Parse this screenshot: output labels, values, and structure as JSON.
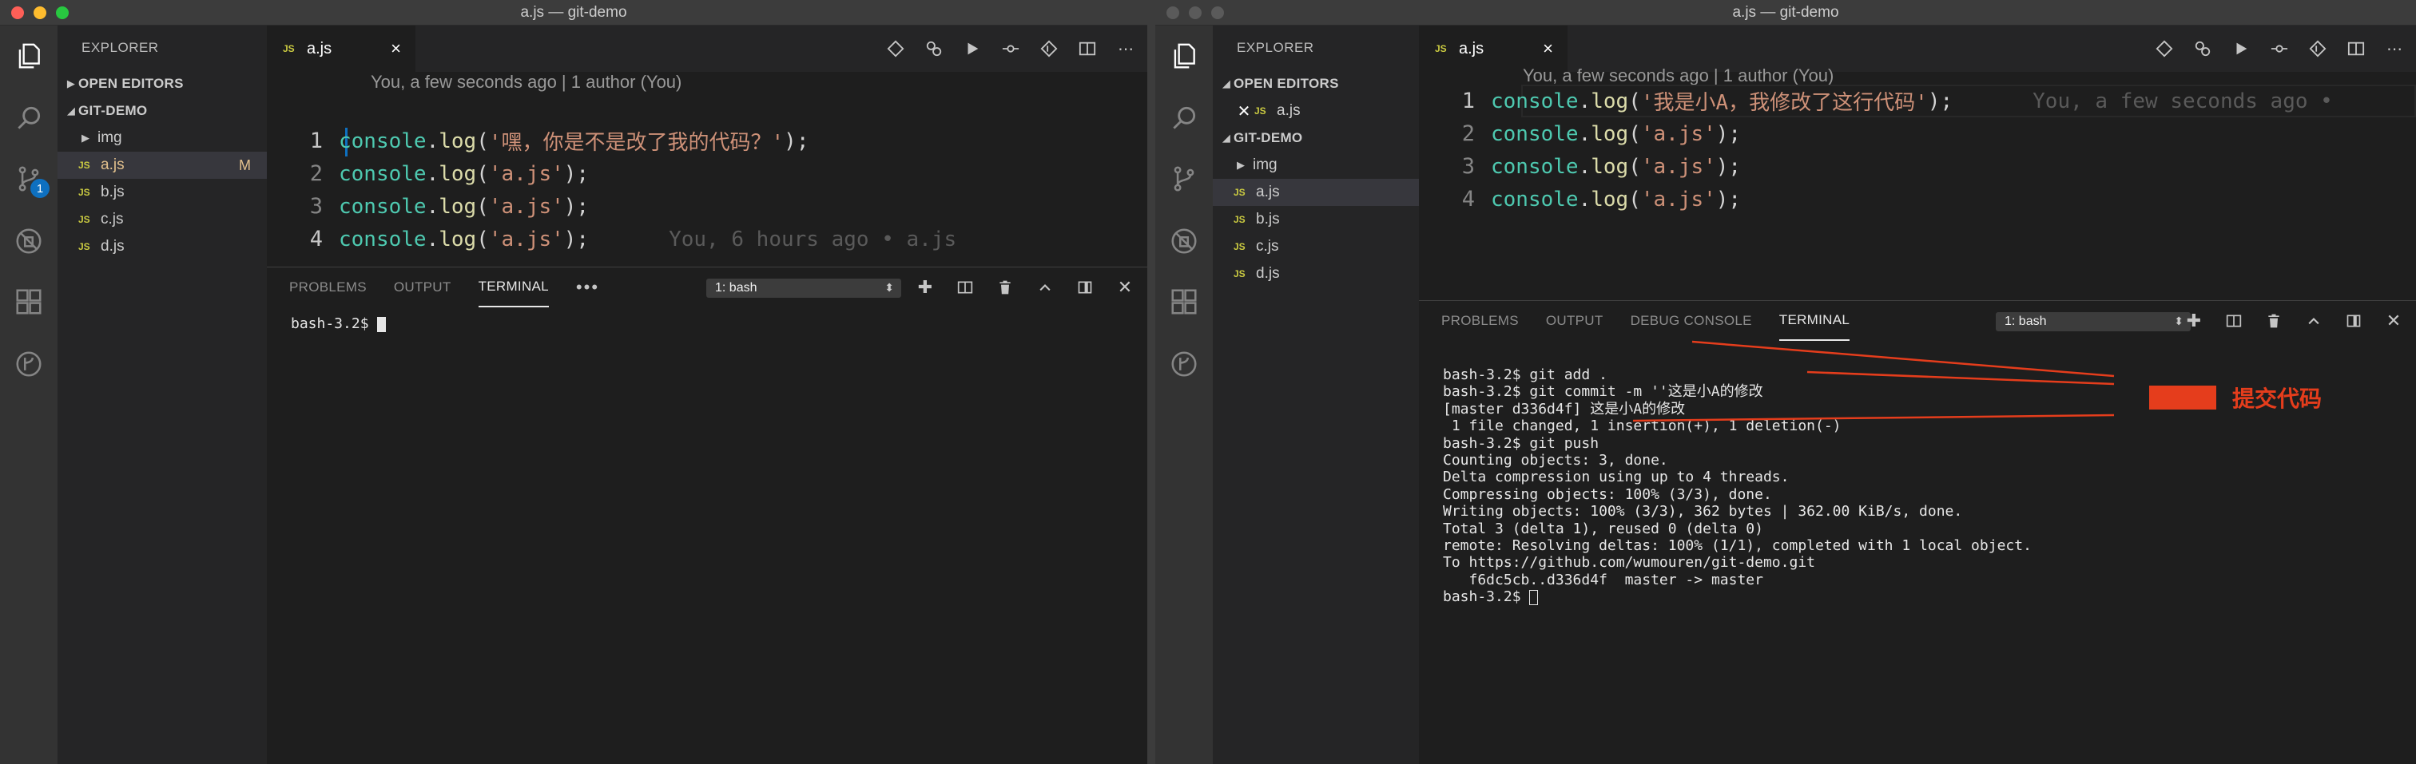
{
  "left": {
    "window_title": "a.js — git-demo",
    "explorer_title": "EXPLORER",
    "sections": {
      "open_editors": "OPEN EDITORS",
      "project": "GIT-DEMO"
    },
    "files": [
      {
        "name": "img",
        "type": "folder"
      },
      {
        "name": "a.js",
        "type": "js",
        "modified": "M"
      },
      {
        "name": "b.js",
        "type": "js"
      },
      {
        "name": "c.js",
        "type": "js"
      },
      {
        "name": "d.js",
        "type": "js"
      }
    ],
    "scm_badge": "1",
    "tab": {
      "icon": "JS",
      "label": "a.js",
      "close": "×"
    },
    "codelens": "You, a few seconds ago | 1 author (You)",
    "code": [
      {
        "num": "1",
        "obj": "console",
        "dot": ".",
        "fn": "log",
        "open": "(",
        "str": "'嘿，你是不是改了我的代码？'",
        "close": ");"
      },
      {
        "num": "2",
        "obj": "console",
        "dot": ".",
        "fn": "log",
        "open": "(",
        "str": "'a.js'",
        "close": ");"
      },
      {
        "num": "3",
        "obj": "console",
        "dot": ".",
        "fn": "log",
        "open": "(",
        "str": "'a.js'",
        "close": ");"
      },
      {
        "num": "4",
        "obj": "console",
        "dot": ".",
        "fn": "log",
        "open": "(",
        "str": "'a.js'",
        "close": ");",
        "blame": "You, 6 hours ago • a.js"
      }
    ],
    "panel_tabs": [
      "PROBLEMS",
      "OUTPUT",
      "TERMINAL"
    ],
    "panel_more": "•••",
    "terminal_select": "1: bash",
    "terminal": [
      "bash-3.2$ "
    ]
  },
  "right": {
    "window_title": "a.js — git-demo",
    "explorer_title": "EXPLORER",
    "sections": {
      "open_editors": "OPEN EDITORS",
      "project": "GIT-DEMO"
    },
    "open_editor_file": "a.js",
    "files": [
      {
        "name": "img",
        "type": "folder"
      },
      {
        "name": "a.js",
        "type": "js"
      },
      {
        "name": "b.js",
        "type": "js"
      },
      {
        "name": "c.js",
        "type": "js"
      },
      {
        "name": "d.js",
        "type": "js"
      }
    ],
    "tab": {
      "icon": "JS",
      "label": "a.js",
      "close": "×"
    },
    "codelens": "You, a few seconds ago | 1 author (You)",
    "code": [
      {
        "num": "1",
        "obj": "console",
        "dot": ".",
        "fn": "log",
        "open": "(",
        "str": "'我是小A，我修改了这行代码'",
        "close": ");",
        "blame": "You, a few seconds ago •"
      },
      {
        "num": "2",
        "obj": "console",
        "dot": ".",
        "fn": "log",
        "open": "(",
        "str": "'a.js'",
        "close": ");"
      },
      {
        "num": "3",
        "obj": "console",
        "dot": ".",
        "fn": "log",
        "open": "(",
        "str": "'a.js'",
        "close": ");"
      },
      {
        "num": "4",
        "obj": "console",
        "dot": ".",
        "fn": "log",
        "open": "(",
        "str": "'a.js'",
        "close": ");"
      }
    ],
    "panel_tabs": [
      "PROBLEMS",
      "OUTPUT",
      "DEBUG CONSOLE",
      "TERMINAL"
    ],
    "terminal_select": "1: bash",
    "terminal": [
      "bash-3.2$ git add .",
      "bash-3.2$ git commit -m ''这是小A的修改",
      "[master d336d4f] 这是小A的修改",
      " 1 file changed, 1 insertion(+), 1 deletion(-)",
      "bash-3.2$ git push",
      "Counting objects: 3, done.",
      "Delta compression using up to 4 threads.",
      "Compressing objects: 100% (3/3), done.",
      "Writing objects: 100% (3/3), 362 bytes | 362.00 KiB/s, done.",
      "Total 3 (delta 1), reused 0 (delta 0)",
      "remote: Resolving deltas: 100% (1/1), completed with 1 local object.",
      "To https://github.com/wumouren/git-demo.git",
      "   f6dc5cb..d336d4f  master -> master",
      "bash-3.2$ "
    ],
    "annotation": {
      "label": "提交代码",
      "color": "#e53d1c"
    }
  }
}
